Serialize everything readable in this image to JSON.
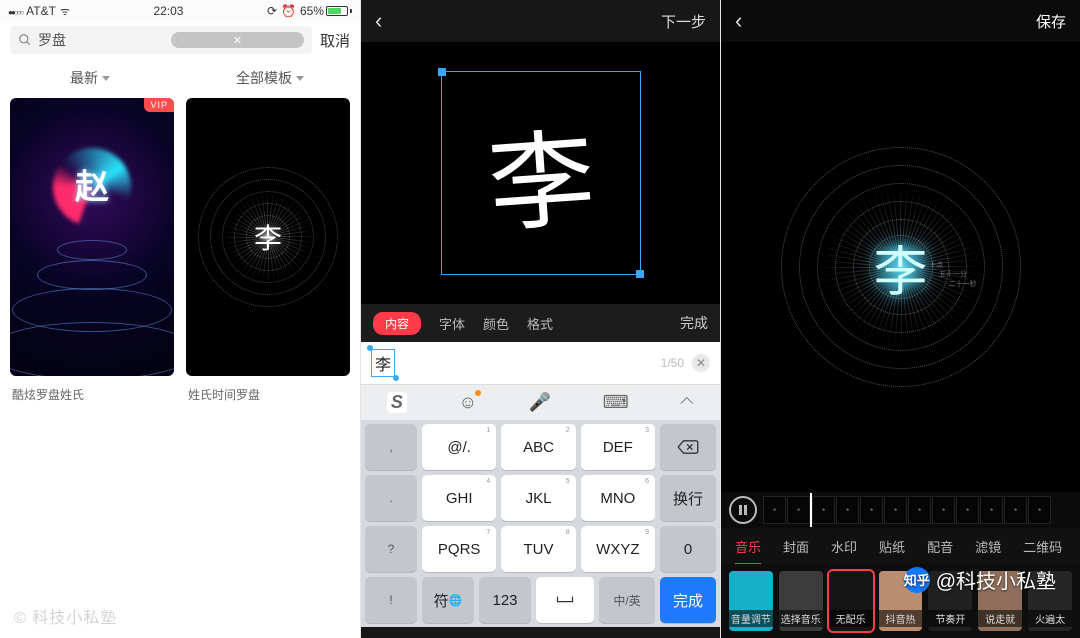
{
  "watermark": {
    "brand_label": "知乎",
    "text": "@科技小私塾"
  },
  "copyright": "© 科技小私塾",
  "p1": {
    "status": {
      "carrier": "AT&T",
      "time": "22:03",
      "battery_pct": "65%"
    },
    "search": {
      "query": "罗盘",
      "cancel": "取消"
    },
    "filters": {
      "left": "最新",
      "right": "全部模板"
    },
    "cards": [
      {
        "vip": "VIP",
        "char": "赵",
        "caption": "酷炫罗盘姓氏"
      },
      {
        "char": "李",
        "caption": "姓氏时间罗盘"
      }
    ]
  },
  "p2": {
    "header": {
      "next": "下一步"
    },
    "char": "李",
    "tabs": {
      "active": "内容",
      "others": [
        "字体",
        "颜色",
        "格式"
      ],
      "done": "完成"
    },
    "input": {
      "value": "李",
      "counter": "1/50"
    },
    "kb": {
      "top_glyphs": [
        "S",
        "☺",
        "🎤",
        "⌨",
        "✕"
      ],
      "rows": [
        [
          ",",
          "@/.",
          "ABC",
          "DEF",
          "⌫"
        ],
        [
          ".",
          "GHI",
          "JKL",
          "MNO",
          "换行"
        ],
        [
          "?",
          "PQRS",
          "TUV",
          "WXYZ",
          "0"
        ],
        [
          "!",
          "符",
          "123",
          "space",
          "中/英",
          "完成"
        ]
      ],
      "sup": [
        "1",
        "2",
        "3",
        "4",
        "5",
        "6",
        "7",
        "8",
        "9"
      ]
    }
  },
  "p3": {
    "header": {
      "save": "保存"
    },
    "char": "李",
    "ring_labels": [
      "十点",
      "五十一分",
      "二十一秒"
    ],
    "option_tabs": [
      "音乐",
      "封面",
      "水印",
      "贴纸",
      "配音",
      "滤镜",
      "二维码"
    ],
    "music": [
      {
        "label": "音量调节",
        "bg": "#17b0c9"
      },
      {
        "label": "选择音乐",
        "bg": "#3b3b3b"
      },
      {
        "label": "无配乐",
        "bg": "#151515",
        "selected": true
      },
      {
        "label": "抖音热",
        "bg": "#b98d6f"
      },
      {
        "label": "节奏开",
        "bg": "#202020"
      },
      {
        "label": "说走就",
        "bg": "#8f6f5c"
      },
      {
        "label": "火遍太",
        "bg": "#262626"
      }
    ]
  }
}
